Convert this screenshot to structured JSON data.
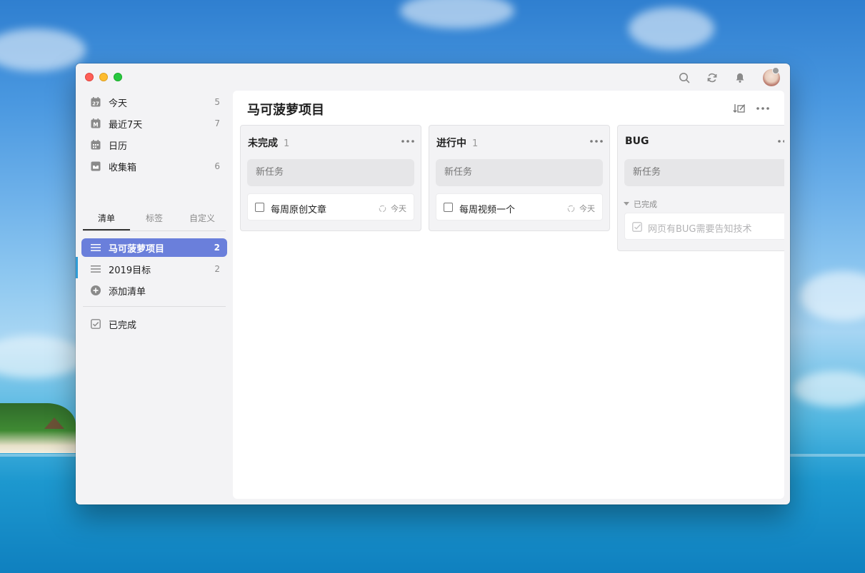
{
  "window": {
    "project_title": "马可菠萝项目"
  },
  "sidebar": {
    "smart_lists": [
      {
        "label": "今天",
        "count": "5",
        "icon": "calendar-today-icon"
      },
      {
        "label": "最近7天",
        "count": "7",
        "icon": "calendar-week-icon"
      },
      {
        "label": "日历",
        "count": "",
        "icon": "calendar-grid-icon"
      },
      {
        "label": "收集箱",
        "count": "6",
        "icon": "inbox-icon"
      }
    ],
    "tabs": [
      {
        "label": "清单"
      },
      {
        "label": "标签"
      },
      {
        "label": "自定义"
      }
    ],
    "lists": [
      {
        "label": "马可菠萝项目",
        "count": "2",
        "active": true
      },
      {
        "label": "2019目标",
        "count": "2",
        "active": false
      }
    ],
    "add_list_label": "添加清单",
    "completed_label": "已完成"
  },
  "board": {
    "columns": [
      {
        "title": "未完成",
        "count": "1",
        "new_task_placeholder": "新任务",
        "tasks": [
          {
            "title": "每周原创文章",
            "due": "今天"
          }
        ]
      },
      {
        "title": "进行中",
        "count": "1",
        "new_task_placeholder": "新任务",
        "tasks": [
          {
            "title": "每周视频一个",
            "due": "今天"
          }
        ]
      },
      {
        "title": "BUG",
        "count": "",
        "new_task_placeholder": "新任务",
        "completed_section": "已完成",
        "completed_tasks": [
          {
            "title": "网页有BUG需要告知技术"
          }
        ]
      }
    ]
  },
  "colors": {
    "accent": "#6a7fdb",
    "list_marker": "#2f9bd6"
  }
}
